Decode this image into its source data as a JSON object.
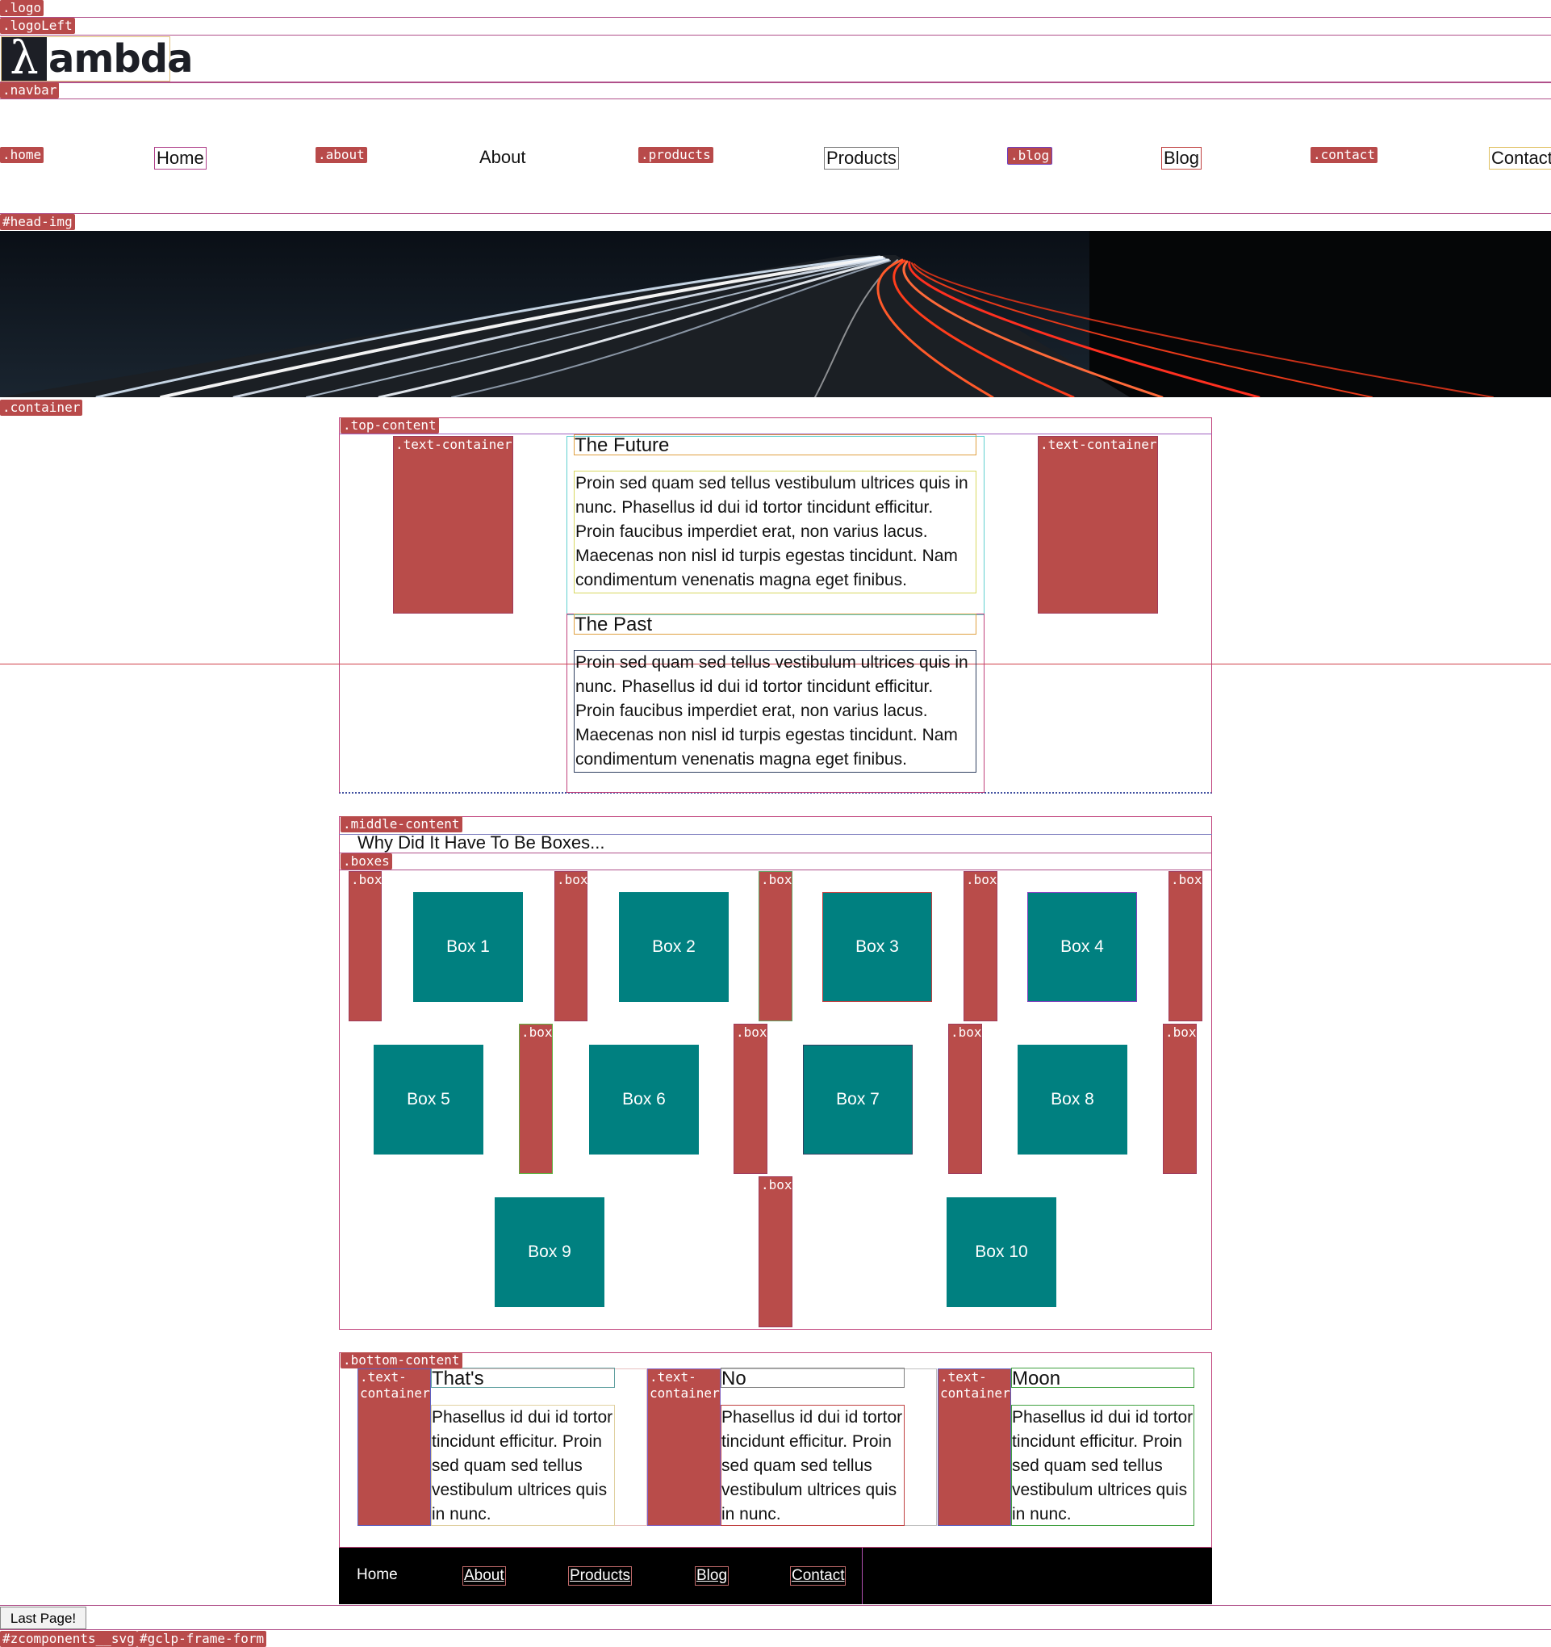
{
  "debug_tags": {
    "logo": ".logo",
    "logo_left": ".logoLeft",
    "navbar": ".navbar",
    "home": ".home",
    "about": ".about",
    "products": ".products",
    "blog": ".blog",
    "contact": ".contact",
    "head_img": "#head-img",
    "container": ".container",
    "top_content": ".top-content",
    "text_container": ".text-container",
    "middle_content": ".middle-content",
    "boxes": ".boxes",
    "box": ".box",
    "bottom_content": ".bottom-content",
    "text_container_wrapped": ".text-\ncontainer",
    "zcomponents": "#zcomponents__svg",
    "gclp": "#gclp-frame-form"
  },
  "logo": {
    "symbol": "λ",
    "text": "ambda"
  },
  "nav": [
    "Home",
    "About",
    "Products",
    "Blog",
    "Contact"
  ],
  "top": {
    "future_title": "The Future",
    "future_text": "Proin sed quam sed tellus vestibulum ultrices quis in nunc. Phasellus id dui id tortor tincidunt efficitur. Proin faucibus imperdiet erat, non varius lacus. Maecenas non nisl id turpis egestas tincidunt. Nam condimentum venenatis magna eget finibus.",
    "past_title": "The Past",
    "past_text": "Proin sed quam sed tellus vestibulum ultrices quis in nunc. Phasellus id dui id tortor tincidunt efficitur. Proin faucibus imperdiet erat, non varius lacus. Maecenas non nisl id turpis egestas tincidunt. Nam condimentum venenatis magna eget finibus."
  },
  "middle": {
    "heading": "Why Did It Have To Be Boxes...",
    "boxes": [
      "Box 1",
      "Box 2",
      "Box 3",
      "Box 4",
      "Box 5",
      "Box 6",
      "Box 7",
      "Box 8",
      "Box 9",
      "Box 10"
    ]
  },
  "bottom": [
    {
      "title": "That's",
      "text": "Phasellus id dui id tortor tincidunt efficitur. Proin sed quam sed tellus vestibulum ultrices quis in nunc."
    },
    {
      "title": "No",
      "text": "Phasellus id dui id tortor tincidunt efficitur. Proin sed quam sed tellus vestibulum ultrices quis in nunc."
    },
    {
      "title": "Moon",
      "text": "Phasellus id dui id tortor tincidunt efficitur. Proin sed quam sed tellus vestibulum ultrices quis in nunc."
    }
  ],
  "footer_nav": [
    "Home",
    "About",
    "Products",
    "Blog",
    "Contact"
  ],
  "last_page_button": "Last Page!",
  "colors": {
    "teal": "#008080",
    "tag_red": "#b84a4a",
    "footer_bg": "#000000"
  }
}
